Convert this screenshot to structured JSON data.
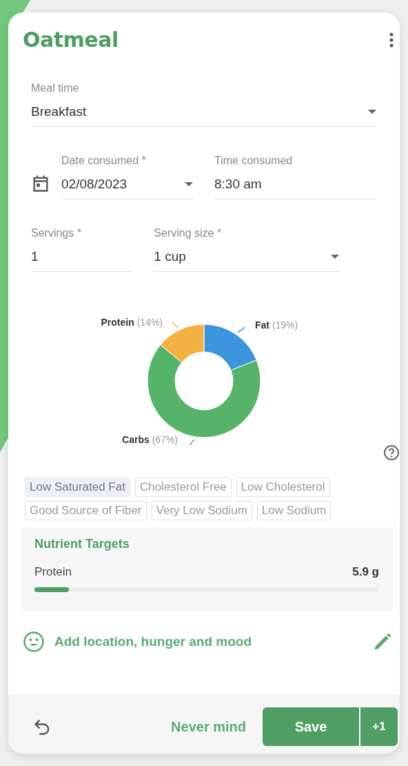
{
  "title": "Oatmeal",
  "field_rows": [
    [
      {
        "label": "Meal time",
        "value": "Breakfast",
        "kind": "select"
      }
    ],
    [
      {
        "label": "Date consumed *",
        "value": "02/08/2023",
        "kind": "date"
      },
      {
        "label": "Time consumed",
        "value": "8:30 am",
        "kind": "text"
      }
    ],
    [
      {
        "label": "Servings *",
        "value": "1",
        "kind": "text"
      },
      {
        "label": "Serving size *",
        "value": "1 cup",
        "kind": "select"
      }
    ]
  ],
  "macros": {
    "chart_data": {
      "type": "donut",
      "categories": [
        "Fat",
        "Carbs",
        "Protein"
      ],
      "values": [
        19,
        67,
        14
      ],
      "colors": [
        "#3d94dc",
        "#55b46a",
        "#f2b140"
      ],
      "value_labels": [
        "(19%)",
        "(67%)",
        "(14%)"
      ]
    }
  },
  "chips": [
    {
      "label": "Low Saturated Fat",
      "selected": true
    },
    {
      "label": "Cholesterol Free",
      "selected": false
    },
    {
      "label": "Low Cholesterol",
      "selected": false
    },
    {
      "label": "Good Source of Fiber",
      "selected": false
    },
    {
      "label": "Very Low Sodium",
      "selected": false
    },
    {
      "label": "Low Sodium",
      "selected": false
    }
  ],
  "nutrient_targets": {
    "title": "Nutrient Targets",
    "items": [
      {
        "name": "Protein",
        "amount": "5.9 g",
        "level": 0.1
      }
    ]
  },
  "details_link": "Add location, hunger and mood",
  "footer": {
    "cancel": "Never mind",
    "save": "Save",
    "save_plus": "+1"
  }
}
